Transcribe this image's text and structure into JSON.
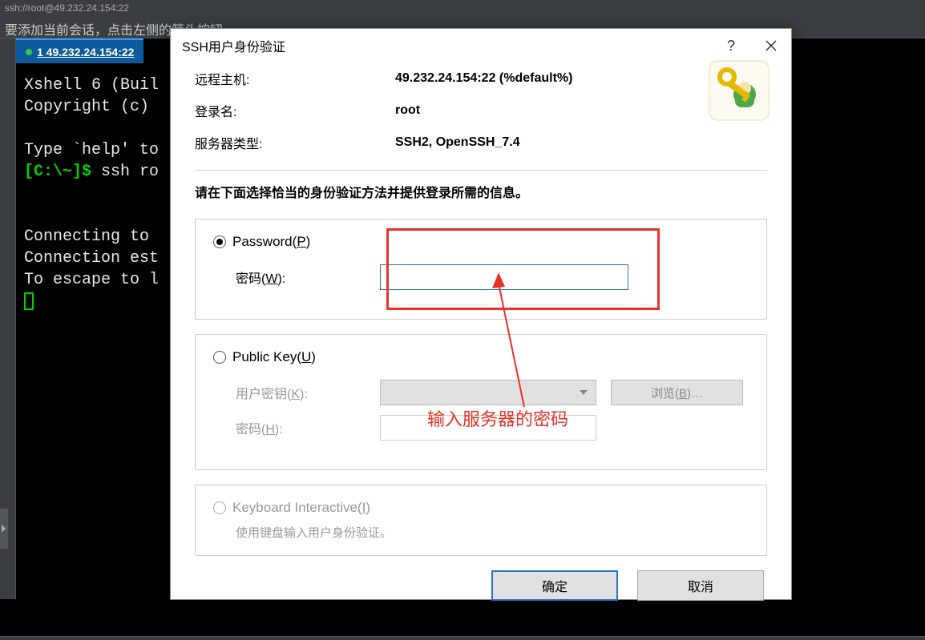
{
  "titlebar": {
    "text": "ssh://root@49.232.24.154:22"
  },
  "hint_bar": "要添加当前会话，点击左侧的箭头按钮。",
  "tab": {
    "label": "1 49.232.24.154:22"
  },
  "terminal": {
    "line1": "Xshell 6 (Buil",
    "line2": "Copyright (c) ",
    "line3": "Type `help' to",
    "prompt": "[C:\\~]$ ",
    "cmd": "ssh ro",
    "line5": "Connecting to ",
    "line6": "Connection est",
    "line7": "To escape to l"
  },
  "dialog": {
    "title": "SSH用户身份验证",
    "info": {
      "host_label": "远程主机:",
      "host_value": "49.232.24.154:22 (%default%)",
      "user_label": "登录名:",
      "user_value": "root",
      "server_label": "服务器类型:",
      "server_value": "SSH2, OpenSSH_7.4"
    },
    "instruction": "请在下面选择恰当的身份验证方法并提供登录所需的信息。",
    "password": {
      "radio_label_pre": "Password(",
      "radio_key": "P",
      "radio_label_post": ")",
      "pwd_label_pre": "密码(",
      "pwd_key": "W",
      "pwd_label_post": "):"
    },
    "pubkey": {
      "radio_label_pre": "Public Key(",
      "radio_key": "U",
      "radio_label_post": ")",
      "userkey_pre": "用户密钥(",
      "userkey_key": "K",
      "userkey_post": "):",
      "pwd_pre": "密码(",
      "pwd_key": "H",
      "pwd_post": "):",
      "browse_pre": "浏览(",
      "browse_key": "B",
      "browse_post": ")…"
    },
    "keyboard": {
      "radio_label_pre": "Keyboard Interactive(",
      "radio_key": "I",
      "radio_label_post": ")",
      "note": "使用键盘输入用户身份验证。"
    },
    "buttons": {
      "ok": "确定",
      "cancel": "取消"
    }
  },
  "annotation": {
    "text": "输入服务器的密码"
  }
}
